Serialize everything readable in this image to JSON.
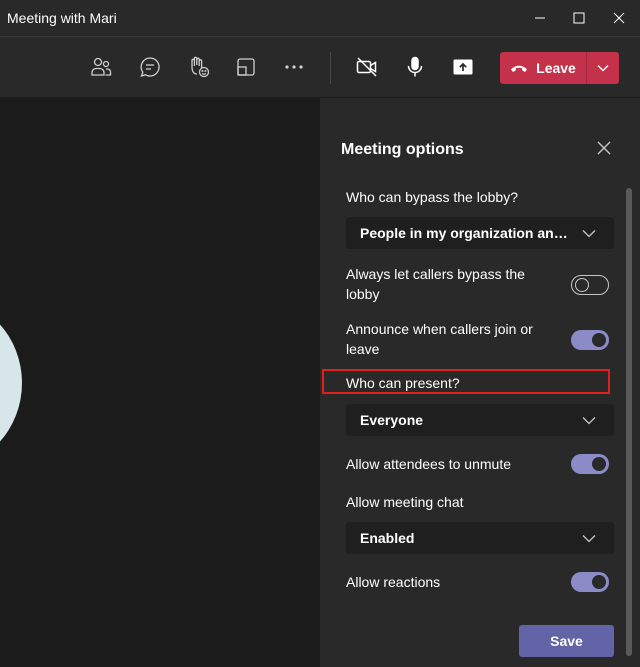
{
  "window": {
    "title": "Meeting with Mari"
  },
  "toolbar": {
    "icons": [
      "people-icon",
      "chat-icon",
      "raise-hand-icon",
      "share-tray-icon",
      "more-icon",
      "camera-off-icon",
      "microphone-icon",
      "share-content-icon"
    ],
    "leave_label": "Leave"
  },
  "panel": {
    "title": "Meeting options",
    "bypass_lobby_label": "Who can bypass the lobby?",
    "bypass_lobby_value": "People in my organization and guests",
    "callers_bypass_label_line1": "Always let callers bypass the",
    "callers_bypass_label_line2": "lobby",
    "callers_bypass_on": false,
    "announce_label_line1": "Announce when callers join or",
    "announce_label_line2": "leave",
    "announce_on": true,
    "who_present_label": "Who can present?",
    "who_present_value": "Everyone",
    "unmute_label": "Allow attendees to unmute",
    "unmute_on": true,
    "chat_label": "Allow meeting chat",
    "chat_value": "Enabled",
    "reactions_label": "Allow reactions",
    "reactions_on": true,
    "save_label": "Save"
  },
  "colors": {
    "accent": "#6264a7",
    "leave": "#c4314b",
    "highlight": "#e0201b",
    "toggle_on": "#8b8cc7"
  }
}
